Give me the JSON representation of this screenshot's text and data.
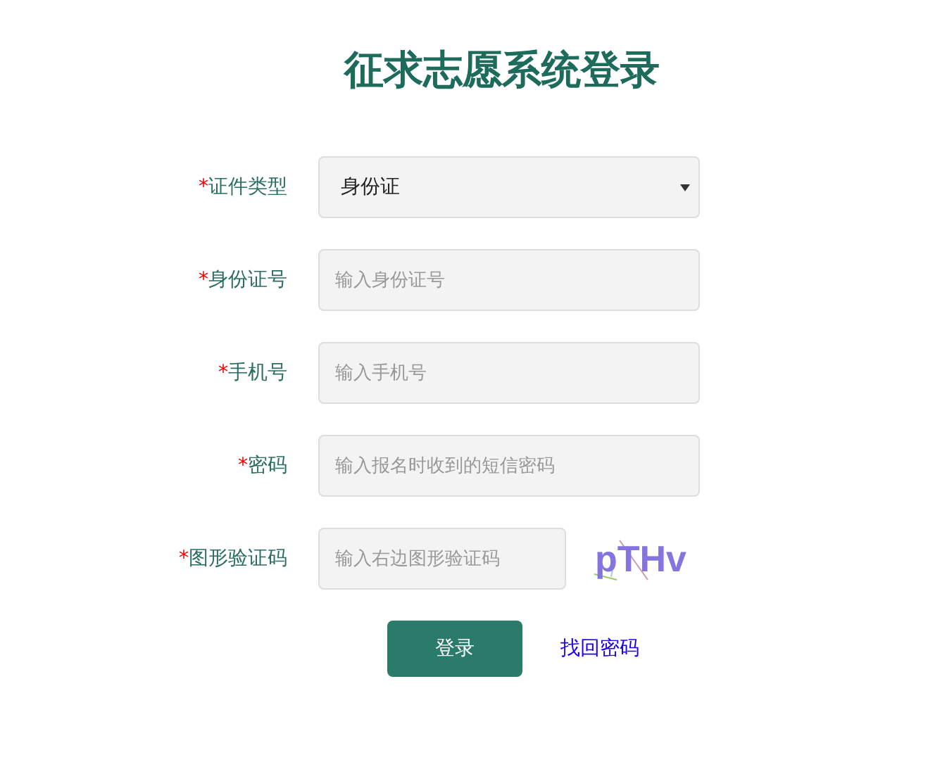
{
  "title": "征求志愿系统登录",
  "fields": [
    {
      "kind": "select",
      "mark": "*",
      "label": "证件类型",
      "value": "身份证"
    },
    {
      "kind": "input",
      "mark": "*",
      "label": "身份证号",
      "placeholder": "输入身份证号"
    },
    {
      "kind": "input",
      "mark": "*",
      "label": "手机号",
      "placeholder": "输入手机号"
    },
    {
      "kind": "input",
      "mark": "*",
      "label": "密码",
      "placeholder": "输入报名时收到的短信密码"
    },
    {
      "kind": "captcha",
      "mark": "*",
      "label": "图形验证码",
      "placeholder": "输入右边图形验证码",
      "captcha": "pTHv"
    }
  ],
  "login_button": "登录",
  "recover_link": "找回密码"
}
